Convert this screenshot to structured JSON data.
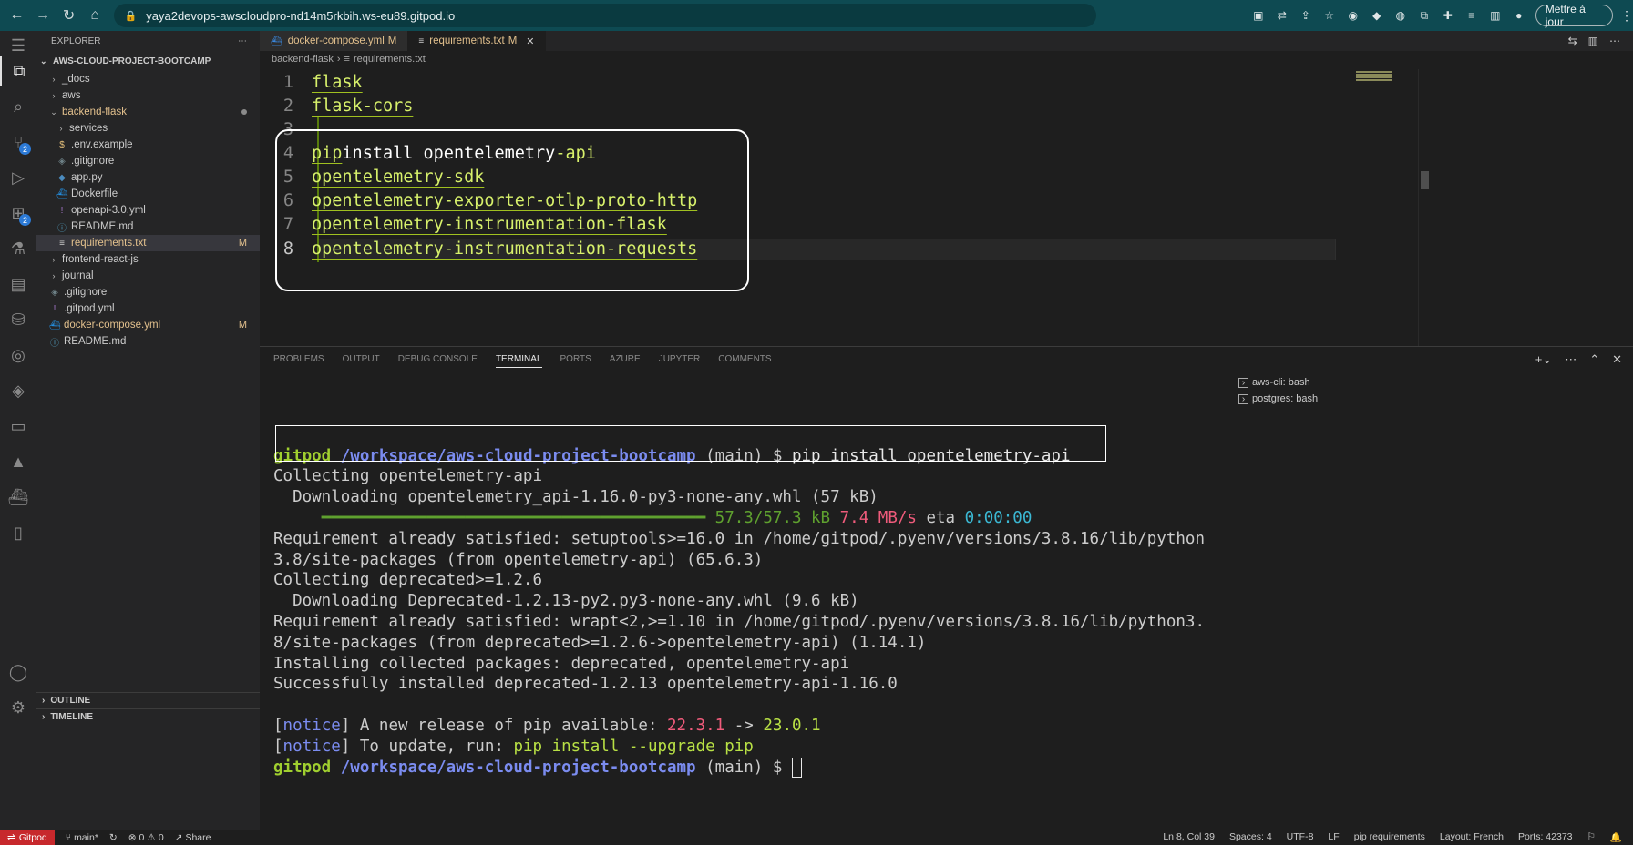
{
  "browser": {
    "url": "yaya2devops-awscloudpro-nd14m5rkbih.ws-eu89.gitpod.io",
    "update_button": "Mettre à jour"
  },
  "sidebar": {
    "title": "EXPLORER",
    "root": "AWS-CLOUD-PROJECT-BOOTCAMP",
    "items": [
      {
        "label": "_docs"
      },
      {
        "label": "aws"
      },
      {
        "label": "backend-flask"
      },
      {
        "label": "services"
      },
      {
        "label": ".env.example"
      },
      {
        "label": ".gitignore"
      },
      {
        "label": "app.py"
      },
      {
        "label": "Dockerfile"
      },
      {
        "label": "openapi-3.0.yml"
      },
      {
        "label": "README.md"
      },
      {
        "label": "requirements.txt",
        "status": "M"
      },
      {
        "label": "frontend-react-js"
      },
      {
        "label": "journal"
      },
      {
        "label": ".gitignore"
      },
      {
        "label": ".gitpod.yml"
      },
      {
        "label": "docker-compose.yml",
        "status": "M"
      },
      {
        "label": "README.md"
      }
    ],
    "outline": "OUTLINE",
    "timeline": "TIMELINE"
  },
  "activity": {
    "scm_badge": "2",
    "ext_badge": "2"
  },
  "tabs": [
    {
      "label": "docker-compose.yml",
      "status": "M"
    },
    {
      "label": "requirements.txt",
      "status": "M"
    }
  ],
  "breadcrumb": {
    "folder": "backend-flask",
    "file": "requirements.txt"
  },
  "editor": {
    "lines": [
      {
        "n": "1",
        "text": "flask"
      },
      {
        "n": "2",
        "text": "flask-cors"
      },
      {
        "n": "3",
        "text": ""
      },
      {
        "n": "4",
        "pip": "pip",
        "middle": " install opentelemetry",
        "tail": "-api"
      },
      {
        "n": "5",
        "text": "opentelemetry-sdk"
      },
      {
        "n": "6",
        "text": "opentelemetry-exporter-otlp-proto-http"
      },
      {
        "n": "7",
        "text": "opentelemetry-instrumentation-flask"
      },
      {
        "n": "8",
        "text": "opentelemetry-instrumentation-requests"
      }
    ]
  },
  "panel": {
    "tabs": [
      "PROBLEMS",
      "OUTPUT",
      "DEBUG CONSOLE",
      "TERMINAL",
      "PORTS",
      "AZURE",
      "JUPYTER",
      "COMMENTS"
    ],
    "terminals": [
      "aws-cli: bash",
      "postgres: bash"
    ]
  },
  "terminal": {
    "prompt_user": "gitpod",
    "prompt_path": "/workspace/aws-cloud-project-bootcamp",
    "prompt_branch": " (main) $ ",
    "command": "pip install opentelemetry-api",
    "l1": "Collecting opentelemetry-api",
    "l2": "  Downloading opentelemetry_api-1.16.0-py3-none-any.whl (57 kB)",
    "l3_bar": "     ━━━━━━━━━━━━━━━━━━━━━━━━━━━━━━━━━━━━━━━━ ",
    "l3_size": "57.3/57.3 kB",
    "l3_speed": "7.4 MB/s",
    "l3_eta_label": " eta ",
    "l3_eta": "0:00:00",
    "l4": "Requirement already satisfied: setuptools>=16.0 in /home/gitpod/.pyenv/versions/3.8.16/lib/python",
    "l5": "3.8/site-packages (from opentelemetry-api) (65.6.3)",
    "l6": "Collecting deprecated>=1.2.6",
    "l7": "  Downloading Deprecated-1.2.13-py2.py3-none-any.whl (9.6 kB)",
    "l8": "Requirement already satisfied: wrapt<2,>=1.10 in /home/gitpod/.pyenv/versions/3.8.16/lib/python3.",
    "l9": "8/site-packages (from deprecated>=1.2.6->opentelemetry-api) (1.14.1)",
    "l10": "Installing collected packages: deprecated, opentelemetry-api",
    "l11": "Successfully installed deprecated-1.2.13 opentelemetry-api-1.16.0",
    "notice": "notice",
    "n1_text": " A new release of pip available: ",
    "n1_old": "22.3.1",
    "n1_arrow": " -> ",
    "n1_new": "23.0.1",
    "n2_text": " To update, run: ",
    "n2_cmd": "pip install --upgrade pip"
  },
  "status": {
    "remote": "Gitpod",
    "branch": "main*",
    "problems": "0",
    "warnings": "0",
    "share": "Share",
    "position": "Ln 8, Col 39",
    "spaces": "Spaces: 4",
    "encoding": "UTF-8",
    "eol": "LF",
    "language": "pip requirements",
    "layout": "Layout: French",
    "ports": "Ports: 42373"
  }
}
